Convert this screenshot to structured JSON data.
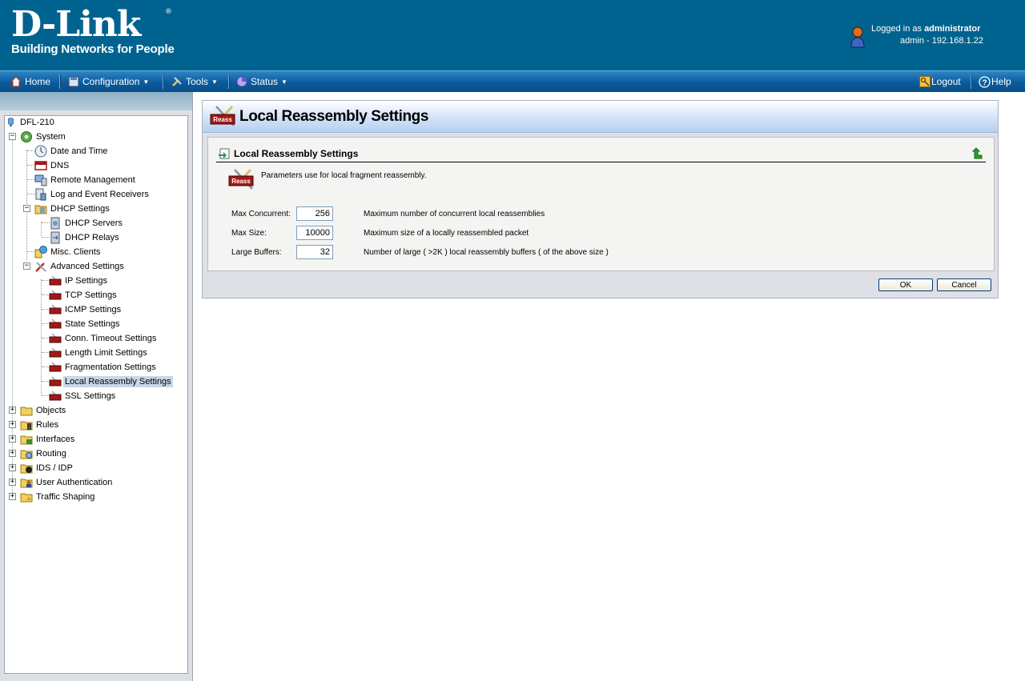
{
  "header": {
    "brand": "D-Link",
    "registered": "®",
    "tagline": "Building Networks for People",
    "logged_in_prefix": "Logged in as",
    "username": "administrator",
    "session": "admin - 192.168.1.22"
  },
  "menu": {
    "home": "Home",
    "configuration": "Configuration",
    "tools": "Tools",
    "status": "Status",
    "logout": "Logout",
    "help": "Help"
  },
  "tree": {
    "root": "DFL-210",
    "system": "System",
    "date_time": "Date and Time",
    "dns": "DNS",
    "remote_mgmt": "Remote Management",
    "log_receivers": "Log and Event Receivers",
    "dhcp_settings": "DHCP Settings",
    "dhcp_servers": "DHCP Servers",
    "dhcp_relays": "DHCP Relays",
    "misc_clients": "Misc. Clients",
    "advanced_settings": "Advanced Settings",
    "ip_settings": "IP Settings",
    "tcp_settings": "TCP Settings",
    "icmp_settings": "ICMP Settings",
    "state_settings": "State Settings",
    "conn_timeout": "Conn. Timeout Settings",
    "length_limit": "Length Limit Settings",
    "fragmentation": "Fragmentation Settings",
    "local_reassembly": "Local Reassembly Settings",
    "ssl_settings": "SSL Settings",
    "objects": "Objects",
    "rules": "Rules",
    "interfaces": "Interfaces",
    "routing": "Routing",
    "ids_idp": "IDS / IDP",
    "user_auth": "User Authentication",
    "traffic_shaping": "Traffic Shaping"
  },
  "page": {
    "title": "Local Reassembly Settings",
    "icon_label": "Reass",
    "section_title": "Local Reassembly Settings",
    "description": "Parameters use for local fragment reassembly.",
    "fields": [
      {
        "label": "Max Concurrent:",
        "value": "256",
        "help": "Maximum number of concurrent local reassemblies"
      },
      {
        "label": "Max Size:",
        "value": "10000",
        "help": "Maximum size of a locally reassembled packet"
      },
      {
        "label": "Large Buffers:",
        "value": "32",
        "help": "Number of large ( >2K ) local reassembly buffers ( of the above size )"
      }
    ],
    "ok_label": "OK",
    "cancel_label": "Cancel"
  },
  "colors": {
    "header_bg": "#00638f",
    "menu_bg": "#0a5a9c",
    "selected_node": "#c8d6e8",
    "title_bar": "#cfe0f7"
  },
  "icons": [
    "home-icon",
    "save-icon",
    "tools-icon",
    "status-icon",
    "logout-key-icon",
    "help-icon",
    "user-avatar-icon",
    "reass-icon",
    "refresh-icon",
    "folder-icon",
    "gear-icon"
  ]
}
